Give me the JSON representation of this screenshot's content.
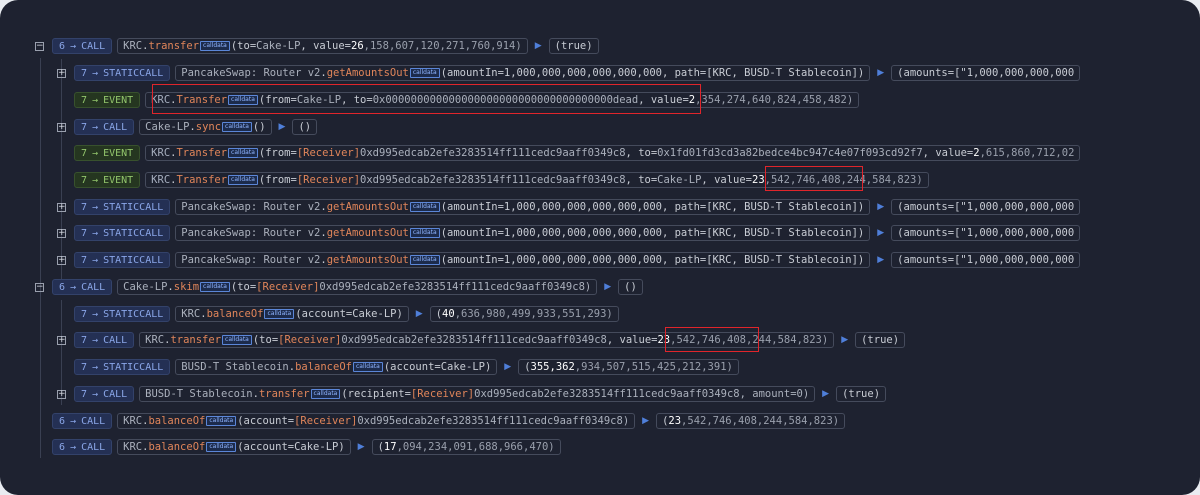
{
  "callout_tag": "calldata",
  "rows": {
    "r1": {
      "toggle": "−",
      "depth": "6",
      "arrow": "→",
      "type": "CALL",
      "contract": "KRC",
      "fn": "transfer",
      "a1": "(to=",
      "a2": "Cake-LP",
      "a3": ", value=",
      "num": "26",
      "rest": ",158,607,120,271,760,914)",
      "result": "(true)"
    },
    "r2": {
      "toggle": "+",
      "depth": "7",
      "arrow": "→",
      "type": "STATICCALL",
      "contract": "PancakeSwap: Router v2",
      "fn": "getAmountsOut",
      "args": "(amountIn=1,000,000,000,000,000,000, path=[KRC, BUSD-T Stablecoin])",
      "result": "(amounts=[\"1,000,000,000,000"
    },
    "r3": {
      "depth": "7",
      "arrow": "→",
      "type": "EVENT",
      "contract": "KRC",
      "fn": "Transfer",
      "a1": "(from=",
      "a2": "Cake-LP",
      "a3": ", to=",
      "a4": "0x000000000000000000000000000000000000dead",
      "a5": ", value=",
      "num": "2",
      "rest": ",354,274,640,824,458,482)"
    },
    "r4": {
      "toggle": "+",
      "depth": "7",
      "arrow": "→",
      "type": "CALL",
      "contract": "Cake-LP",
      "fn": "sync",
      "args": "()",
      "result": "()"
    },
    "r5": {
      "depth": "7",
      "arrow": "→",
      "type": "EVENT",
      "contract": "KRC",
      "fn": "Transfer",
      "a1": "(from=",
      "a2": "[Receiver]",
      "a3": "0xd995edcab2efe3283514ff111cedc9aaff0349c8",
      "a4": ", to=",
      "a5": "0x1fd01fd3cd3a82bedce4bc947c4e07f093cd92f7",
      "a6": ", value=",
      "num": "2",
      "rest": ",615,860,712,02"
    },
    "r6": {
      "depth": "7",
      "arrow": "→",
      "type": "EVENT",
      "contract": "KRC",
      "fn": "Transfer",
      "a1": "(from=",
      "a2": "[Receiver]",
      "a3": "0xd995edcab2efe3283514ff111cedc9aaff0349c8",
      "a4": ", to=",
      "a5": "Cake-LP",
      "a6": ", value=",
      "num": "23",
      "mid": ",542",
      "rest": ",746,408,244,584,823)"
    },
    "r7": {
      "toggle": "+",
      "depth": "7",
      "arrow": "→",
      "type": "STATICCALL",
      "contract": "PancakeSwap: Router v2",
      "fn": "getAmountsOut",
      "args": "(amountIn=1,000,000,000,000,000,000, path=[KRC, BUSD-T Stablecoin])",
      "result": "(amounts=[\"1,000,000,000,000"
    },
    "r8": {
      "toggle": "+",
      "depth": "7",
      "arrow": "→",
      "type": "STATICCALL",
      "contract": "PancakeSwap: Router v2",
      "fn": "getAmountsOut",
      "args": "(amountIn=1,000,000,000,000,000,000, path=[KRC, BUSD-T Stablecoin])",
      "result": "(amounts=[\"1,000,000,000,000"
    },
    "r9": {
      "toggle": "+",
      "depth": "7",
      "arrow": "→",
      "type": "STATICCALL",
      "contract": "PancakeSwap: Router v2",
      "fn": "getAmountsOut",
      "args": "(amountIn=1,000,000,000,000,000,000, path=[KRC, BUSD-T Stablecoin])",
      "result": "(amounts=[\"1,000,000,000,000"
    },
    "r10": {
      "toggle": "−",
      "depth": "6",
      "arrow": "→",
      "type": "CALL",
      "contract": "Cake-LP",
      "fn": "skim",
      "a1": "(to=",
      "a2": "[Receiver]",
      "a3": "0xd995edcab2efe3283514ff111cedc9aaff0349c8)",
      "result": "()"
    },
    "r11": {
      "depth": "7",
      "arrow": "→",
      "type": "STATICCALL",
      "contract": "KRC",
      "fn": "balanceOf",
      "args": "(account=Cake-LP)",
      "rnum": "40",
      "rrest": ",636,980,499,933,551,293)"
    },
    "r12": {
      "toggle": "+",
      "depth": "7",
      "arrow": "→",
      "type": "CALL",
      "contract": "KRC",
      "fn": "transfer",
      "a1": "(to=",
      "a2": "[Receiver]",
      "a3": "0xd995edcab2efe3283514ff111cedc9aaff0349c8",
      "a4": ", value=",
      "num": "23",
      "mid": ",542",
      "rest": ",746,408,244,584,823)",
      "result": "(true)"
    },
    "r13": {
      "depth": "7",
      "arrow": "→",
      "type": "STATICCALL",
      "contract": "BUSD-T Stablecoin",
      "fn": "balanceOf",
      "args": "(account=Cake-LP)",
      "rnum": "355,362",
      "rrest": ",934,507,515,425,212,391)"
    },
    "r14": {
      "toggle": "+",
      "depth": "7",
      "arrow": "→",
      "type": "CALL",
      "contract": "BUSD-T Stablecoin",
      "fn": "transfer",
      "a1": "(recipient=",
      "a2": "[Receiver]",
      "a3": "0xd995edcab2efe3283514ff111cedc9aaff0349c8, amount=0)",
      "result": "(true)"
    },
    "r15": {
      "depth": "6",
      "arrow": "→",
      "type": "CALL",
      "contract": "KRC",
      "fn": "balanceOf",
      "a1": "(account=",
      "a2": "[Receiver]",
      "a3": "0xd995edcab2efe3283514ff111cedc9aaff0349c8)",
      "rnum": "23",
      "rrest": ",542,746,408,244,584,823)"
    },
    "r16": {
      "depth": "6",
      "arrow": "→",
      "type": "CALL",
      "contract": "KRC",
      "fn": "balanceOf",
      "args": "(account=Cake-LP)",
      "rnum": "17",
      "rrest": ",094,234,091,688,966,470)"
    }
  }
}
